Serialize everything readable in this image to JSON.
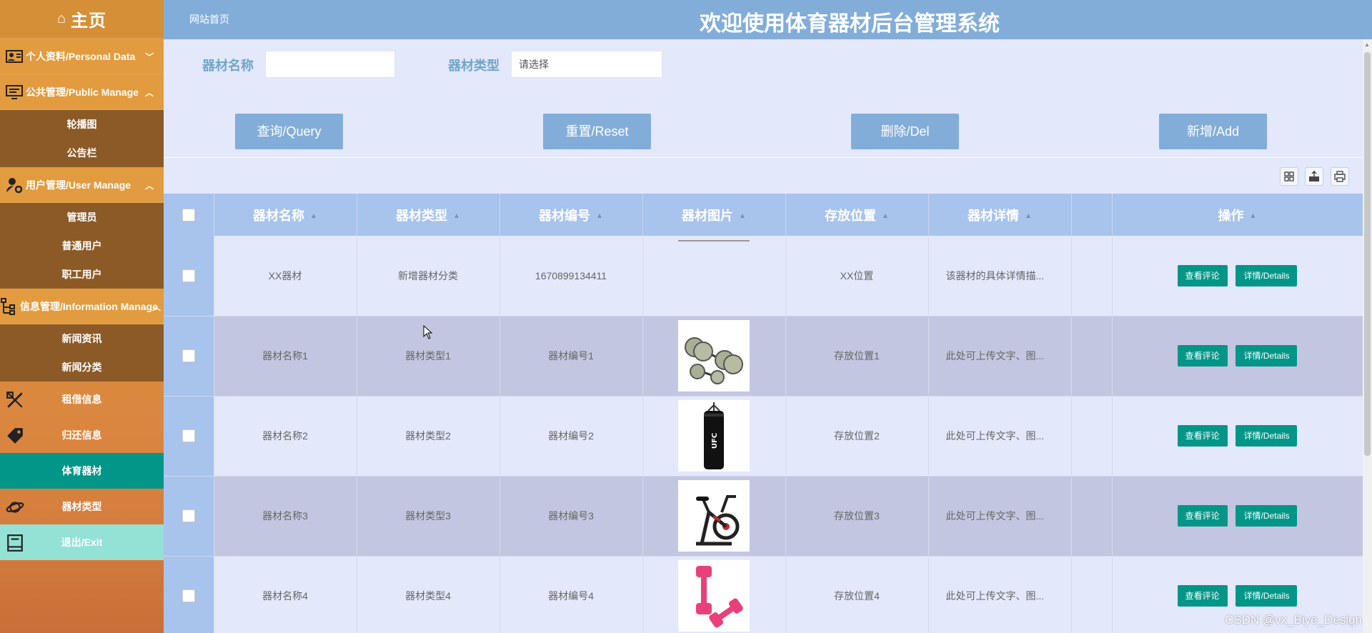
{
  "sidebar": {
    "home": "主页",
    "groups": [
      {
        "label": "个人资料/Personal Data",
        "chev": "﹀",
        "items": []
      },
      {
        "label": "公共管理/Public Manage",
        "chev": "︿",
        "items": [
          "轮播图",
          "公告栏"
        ]
      },
      {
        "label": "用户管理/User Manage",
        "chev": "︿",
        "items": [
          "管理员",
          "普通用户",
          "职工用户"
        ]
      },
      {
        "label": "信息管理/Information Manage",
        "chev": "︿",
        "items": [
          "新闻资讯",
          "新闻分类"
        ]
      }
    ],
    "links": [
      "租借信息",
      "归还信息",
      "体育器材",
      "器材类型",
      "退出/Exit"
    ]
  },
  "header": {
    "home_link": "网站首页",
    "title": "欢迎使用体育器材后台管理系统"
  },
  "search": {
    "name_label": "器材名称",
    "name_value": "",
    "type_label": "器材类型",
    "type_placeholder": "请选择"
  },
  "buttons": {
    "query": "查询/Query",
    "reset": "重置/Reset",
    "delete": "删除/Del",
    "add": "新增/Add"
  },
  "table": {
    "columns": [
      "器材名称",
      "器材类型",
      "器材编号",
      "器材图片",
      "存放位置",
      "器材详情",
      "",
      "操作"
    ],
    "rows": [
      {
        "name": "XX器材",
        "type": "新增器材分类",
        "code": "1670899134411",
        "location": "XX位置",
        "detail": "该器材的具体详情描..."
      },
      {
        "name": "器材名称1",
        "type": "器材类型1",
        "code": "器材编号1",
        "location": "存放位置1",
        "detail": "此处可上传文字、图..."
      },
      {
        "name": "器材名称2",
        "type": "器材类型2",
        "code": "器材编号2",
        "location": "存放位置2",
        "detail": "此处可上传文字、图..."
      },
      {
        "name": "器材名称3",
        "type": "器材类型3",
        "code": "器材编号3",
        "location": "存放位置3",
        "detail": "此处可上传文字、图..."
      },
      {
        "name": "器材名称4",
        "type": "器材类型4",
        "code": "器材编号4",
        "location": "存放位置4",
        "detail": "此处可上传文字、图..."
      }
    ],
    "op_review": "查看评论",
    "op_details": "详情/Details"
  },
  "watermark": "CSDN @vx_Biye_Design",
  "colors": {
    "accent": "#019688",
    "header": "#83add9",
    "sidebar": "#e09a3c"
  }
}
